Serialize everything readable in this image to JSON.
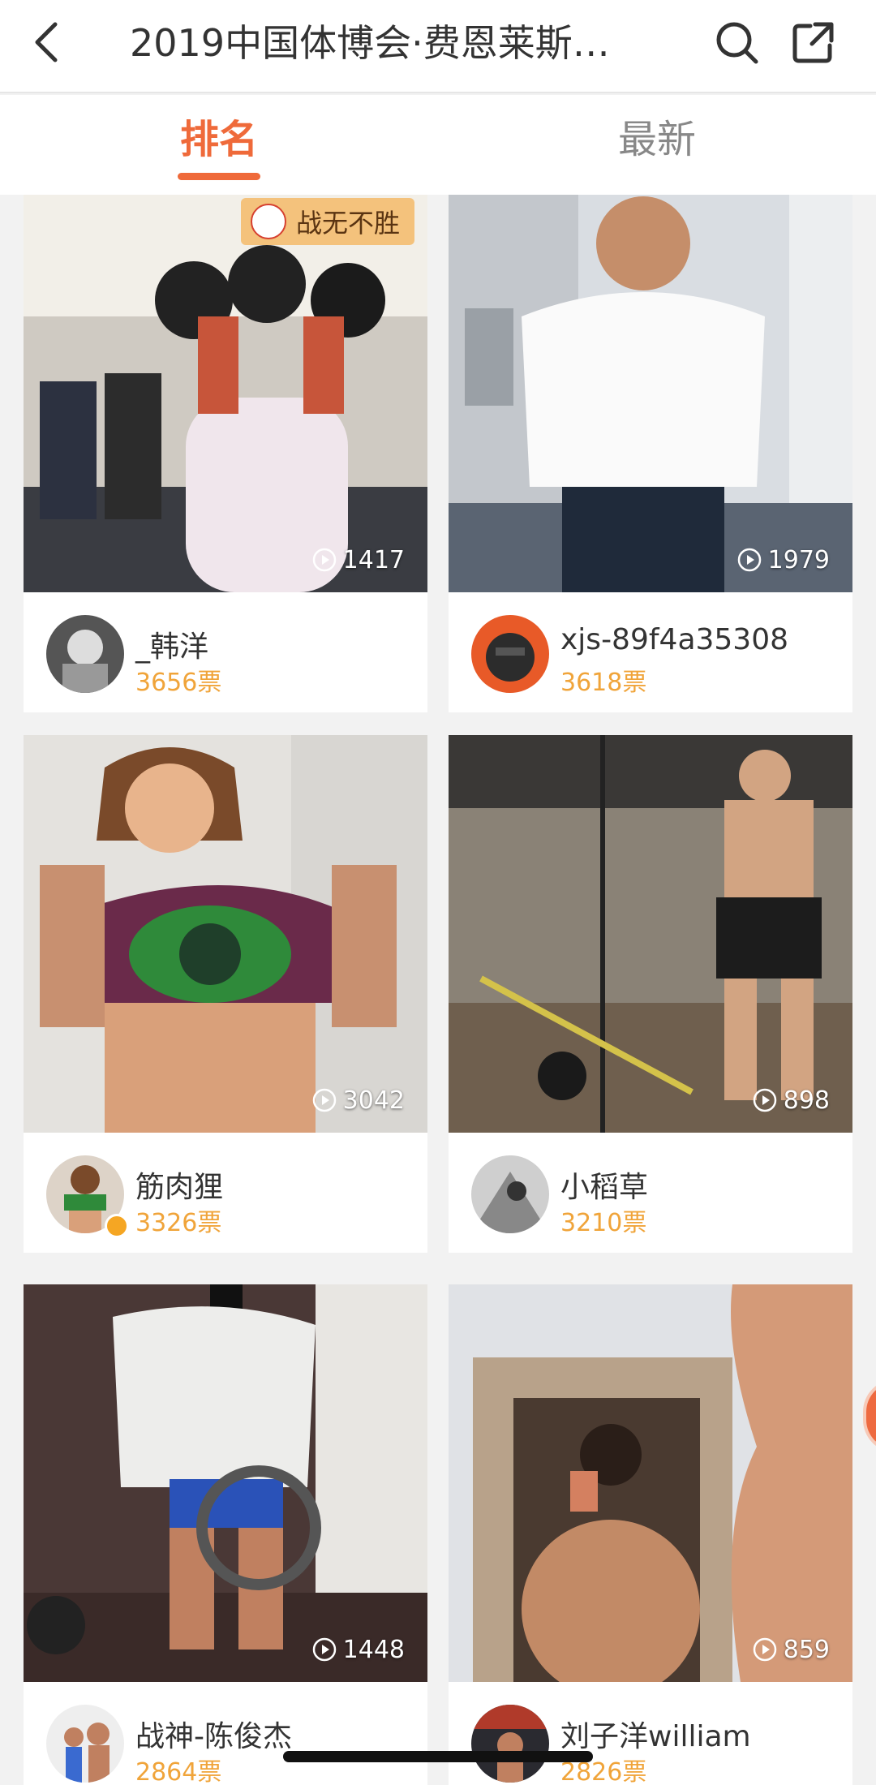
{
  "header": {
    "title": "2019中国体博会·费恩莱斯…"
  },
  "tabs": [
    {
      "label": "排名",
      "active": true
    },
    {
      "label": "最新",
      "active": false
    }
  ],
  "badge": {
    "label": "战无不胜"
  },
  "videos": [
    {
      "views": "1417",
      "name": "_韩洋",
      "votes": "3656票"
    },
    {
      "views": "1979",
      "name": "xjs-89f4a35308",
      "votes": "3618票"
    },
    {
      "views": "3042",
      "name": "筋肉狸",
      "votes": "3326票",
      "verified": true
    },
    {
      "views": "898",
      "name": "小稻草",
      "votes": "3210票"
    },
    {
      "views": "1448",
      "name": "战神-陈俊杰",
      "votes": "2864票"
    },
    {
      "views": "859",
      "name": "刘子洋william",
      "votes": "2826票"
    }
  ],
  "colors": {
    "accent": "#ef6a3a",
    "votes": "#f0a43a",
    "badge_bg": "#f4c27c"
  },
  "icons": [
    "back-icon",
    "search-icon",
    "share-icon",
    "play-icon",
    "verified-icon"
  ]
}
